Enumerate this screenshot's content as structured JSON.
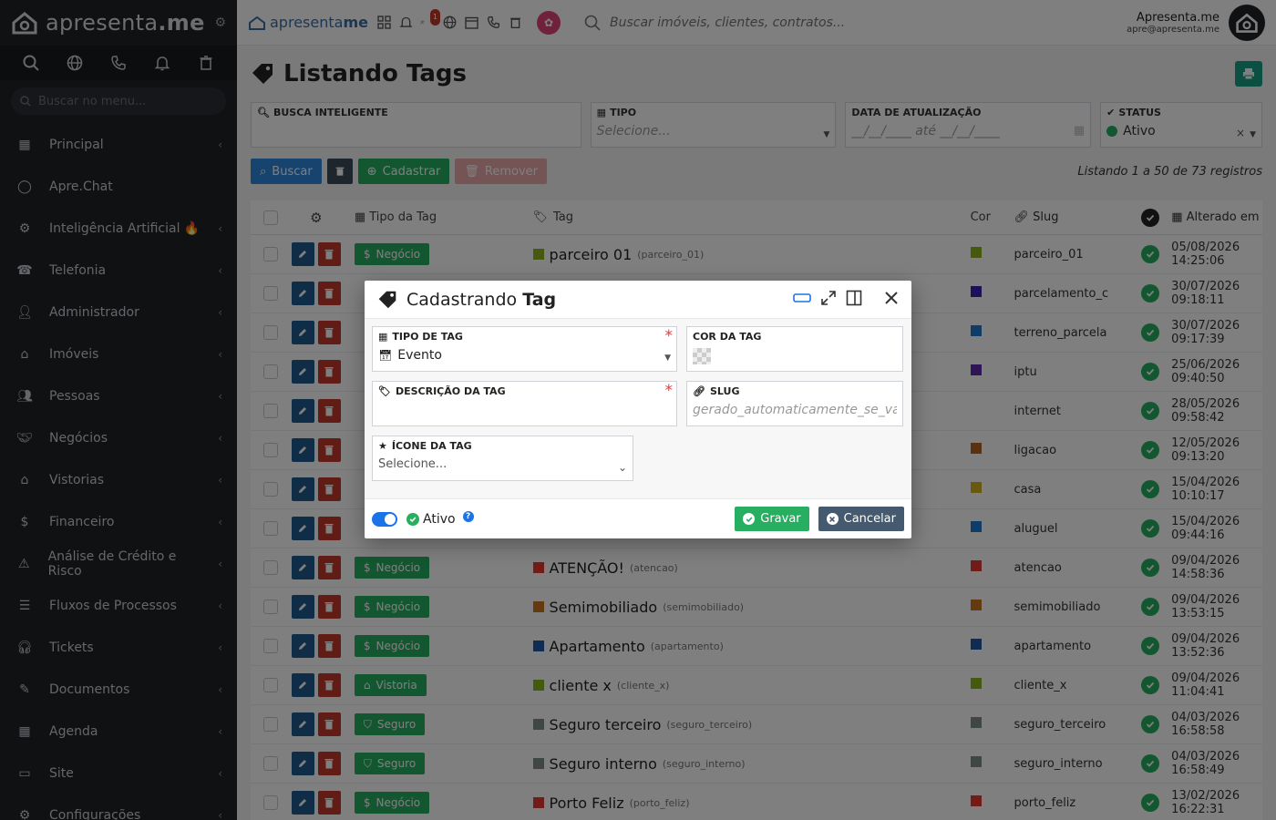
{
  "sidebar": {
    "brand": "apresenta",
    "brand_suffix": ".me",
    "search_placeholder": "Buscar no menu...",
    "items": [
      {
        "label": "Principal",
        "icon": "dashboard-icon"
      },
      {
        "label": "Apre.Chat",
        "icon": "whatsapp-icon"
      },
      {
        "label": "Inteligência Artificial 🔥",
        "icon": "robot-icon"
      },
      {
        "label": "Telefonia",
        "icon": "phone-icon"
      },
      {
        "label": "Administrador",
        "icon": "user-admin-icon"
      },
      {
        "label": "Imóveis",
        "icon": "home-icon"
      },
      {
        "label": "Pessoas",
        "icon": "people-icon"
      },
      {
        "label": "Negócios",
        "icon": "handshake-icon"
      },
      {
        "label": "Vistorias",
        "icon": "house-check-icon"
      },
      {
        "label": "Financeiro",
        "icon": "dollar-icon"
      },
      {
        "label": "Análise de Crédito e Risco",
        "icon": "warning-icon"
      },
      {
        "label": "Fluxos de Processos",
        "icon": "filter-icon"
      },
      {
        "label": "Tickets",
        "icon": "headset-icon"
      },
      {
        "label": "Documentos",
        "icon": "document-edit-icon"
      },
      {
        "label": "Agenda",
        "icon": "calendar-icon"
      },
      {
        "label": "Site",
        "icon": "browser-icon"
      },
      {
        "label": "Configurações",
        "icon": "gears-icon"
      }
    ]
  },
  "topbar": {
    "logo": "apresenta",
    "logo_suffix": "me",
    "notification_count": "1",
    "search_placeholder": "Buscar imóveis, clientes, contratos...",
    "user_name": "Apresenta.me",
    "user_email": "apre@apresenta.me"
  },
  "page": {
    "title_prefix": "Listando ",
    "title_main": "Tags"
  },
  "filters": {
    "busca_label": "BUSCA INTELIGENTE",
    "tipo_label": "TIPO",
    "tipo_placeholder": "Selecione...",
    "data_label": "DATA DE ATUALIZAÇÃO",
    "data_placeholder": "__/__/____  até  __/__/____",
    "status_label": "STATUS",
    "status_value": "Ativo"
  },
  "actions": {
    "buscar": "Buscar",
    "cadastrar": "Cadastrar",
    "remover": "Remover",
    "count_text": "Listando 1 a 50 de 73 registros"
  },
  "table": {
    "headers": {
      "tipo": "Tipo da Tag",
      "tag": "Tag",
      "cor": "Cor",
      "slug": "Slug",
      "alterado": "Alterado em"
    },
    "rows": [
      {
        "tipo": "Negócio",
        "tag": "parceiro 01",
        "slug_small": "(parceiro_01)",
        "slug": "parceiro_01",
        "date": "05/08/2026",
        "time": "14:25:06",
        "color": "#8bb21f"
      },
      {
        "tipo": "",
        "tag": "",
        "slug_small": "",
        "slug": "parcelamento_c",
        "date": "30/07/2026",
        "time": "09:18:11",
        "color": "#3a1fb2"
      },
      {
        "tipo": "",
        "tag": "",
        "slug_small": "",
        "slug": "terreno_parcela",
        "date": "30/07/2026",
        "time": "09:17:39",
        "color": "#1f78d1"
      },
      {
        "tipo": "",
        "tag": "",
        "slug_small": "",
        "slug": "iptu",
        "date": "25/06/2026",
        "time": "09:40:50",
        "color": "#5a2ab0"
      },
      {
        "tipo": "",
        "tag": "",
        "slug_small": "",
        "slug": "internet",
        "date": "28/05/2026",
        "time": "09:58:42",
        "color": ""
      },
      {
        "tipo": "",
        "tag": "",
        "slug_small": "",
        "slug": "ligacao",
        "date": "12/05/2026",
        "time": "09:13:20",
        "color": "#b8621f"
      },
      {
        "tipo": "",
        "tag": "",
        "slug_small": "",
        "slug": "casa",
        "date": "15/04/2026",
        "time": "10:10:17",
        "color": "#d6b11f"
      },
      {
        "tipo": "",
        "tag": "",
        "slug_small": "",
        "slug": "aluguel",
        "date": "15/04/2026",
        "time": "09:44:16",
        "color": "#1f78d1"
      },
      {
        "tipo": "Negócio",
        "tag": "ATENÇÃO!",
        "slug_small": "(atencao)",
        "slug": "atencao",
        "date": "09/04/2026",
        "time": "14:58:36",
        "color": "#e53935"
      },
      {
        "tipo": "Negócio",
        "tag": "Semimobiliado",
        "slug_small": "(semimobiliado)",
        "slug": "semimobiliado",
        "date": "09/04/2026",
        "time": "13:53:15",
        "color": "#c9771f"
      },
      {
        "tipo": "Negócio",
        "tag": "Apartamento",
        "slug_small": "(apartamento)",
        "slug": "apartamento",
        "date": "09/04/2026",
        "time": "13:52:36",
        "color": "#1f5aa8"
      },
      {
        "tipo": "Vistoria",
        "tag": "cliente x",
        "slug_small": "(cliente_x)",
        "slug": "cliente_x",
        "date": "09/04/2026",
        "time": "11:04:41",
        "color": "#8bb21f"
      },
      {
        "tipo": "Seguro",
        "tag": "Seguro terceiro",
        "slug_small": "(seguro_terceiro)",
        "slug": "seguro_terceiro",
        "date": "04/03/2026",
        "time": "16:58:58",
        "color": "#7f8c8d"
      },
      {
        "tipo": "Seguro",
        "tag": "Seguro interno",
        "slug_small": "(seguro_interno)",
        "slug": "seguro_interno",
        "date": "04/03/2026",
        "time": "16:58:49",
        "color": "#7f8c8d"
      },
      {
        "tipo": "Negócio",
        "tag": "Porto Feliz",
        "slug_small": "(porto_feliz)",
        "slug": "porto_feliz",
        "date": "13/02/2026",
        "time": "16:22:31",
        "color": "#e53935"
      }
    ]
  },
  "modal": {
    "title_prefix": "Cadastrando ",
    "title_main": "Tag",
    "tipo_label": "TIPO DE TAG",
    "tipo_value": "Evento",
    "cor_label": "COR DA TAG",
    "descricao_label": "DESCRIÇÃO DA TAG",
    "slug_label": "SLUG",
    "slug_placeholder": "gerado_automaticamente_se_vazio",
    "icone_label": "ÍCONE DA TAG",
    "icone_placeholder": "Selecione...",
    "ativo_label": "Ativo",
    "help": "?",
    "gravar": "Gravar",
    "cancelar": "Cancelar"
  },
  "colors": {
    "accent": "#2e86de",
    "success": "#27ae60",
    "danger": "#c0392b",
    "sidebar_bg": "#1f2327"
  }
}
